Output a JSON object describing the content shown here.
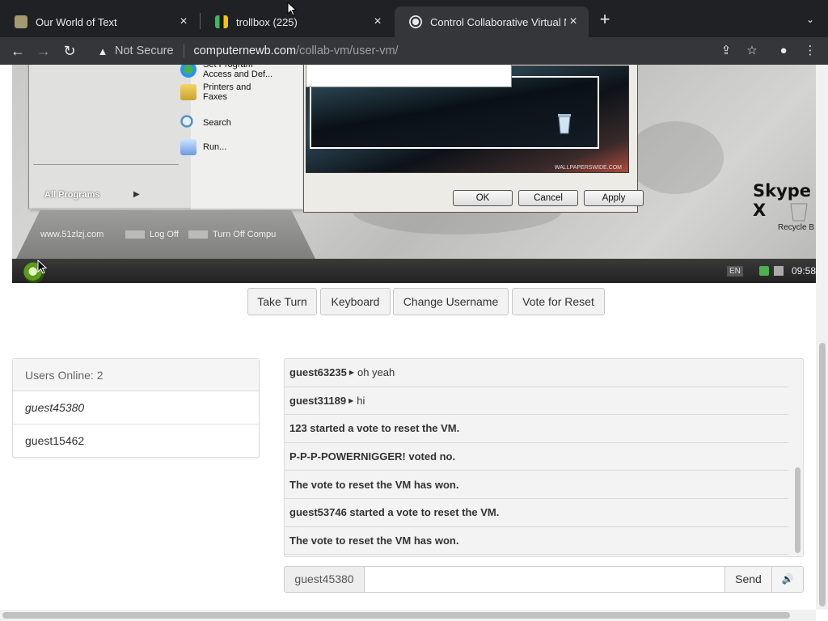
{
  "browser": {
    "tabs": [
      {
        "title": "Our World of Text",
        "active": false,
        "favicon": "owot-icon"
      },
      {
        "title": "trollbox (225)",
        "active": false,
        "favicon": "trollbox-icon"
      },
      {
        "title": "Control Collaborative Virtual M",
        "active": true,
        "favicon": "collabvm-icon"
      }
    ],
    "new_tab": "+",
    "address": {
      "security_label": "Not Secure",
      "host": "computernewb.com",
      "path": "/collab-vm/user-vm/"
    }
  },
  "vm": {
    "start_menu": {
      "items": [
        "Set Program Access and Def...",
        "Printers and Faxes",
        "Search",
        "Run..."
      ],
      "all_programs": "All Programs",
      "log_off": "Log Off",
      "turn_off": "Turn Off Compu",
      "site": "www.51zlzj.com"
    },
    "dialog": {
      "ok": "OK",
      "cancel": "Cancel",
      "apply": "Apply",
      "watermark": "WALLPAPERSWIDE.COM"
    },
    "desktop": {
      "skype": "Skype X",
      "recycle": "Recycle B"
    },
    "taskbar": {
      "lang": "EN",
      "clock": "09:58"
    }
  },
  "actions": {
    "take_turn": "Take Turn",
    "keyboard": "Keyboard",
    "change_username": "Change Username",
    "vote_reset": "Vote for Reset"
  },
  "users": {
    "header": "Users Online: 2",
    "list": [
      "guest45380",
      "guest15462"
    ]
  },
  "chat": {
    "messages": [
      {
        "user": "guest63235",
        "text": "oh yeah"
      },
      {
        "user": "guest31189",
        "text": "hi"
      },
      {
        "system": "123 started a vote to reset the VM."
      },
      {
        "system": "P-P-P-POWERNIGGER! voted no."
      },
      {
        "system": "The vote to reset the VM has won."
      },
      {
        "system": "guest53746 started a vote to reset the VM."
      },
      {
        "system": "The vote to reset the VM has won."
      }
    ],
    "username": "guest45380",
    "input_value": "",
    "send": "Send",
    "volume_icon": "volume-icon"
  },
  "colors": {
    "browser_bg": "#202124",
    "toolbar_bg": "#35363a",
    "panel_bg": "#f3f3f3",
    "button_bg": "#f2f2f2"
  }
}
